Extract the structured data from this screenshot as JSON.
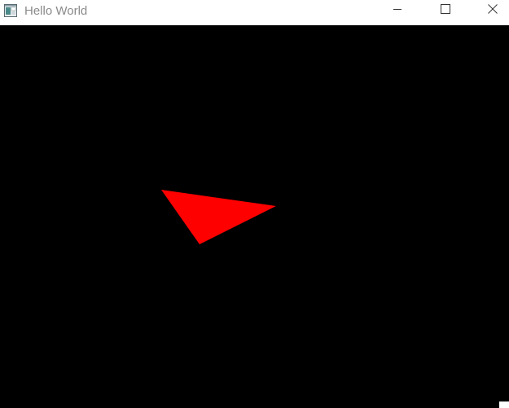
{
  "window": {
    "title": "Hello World"
  },
  "icons": {
    "app": "app-window-icon",
    "minimize": "minimize-icon",
    "maximize": "maximize-icon",
    "close": "close-icon"
  },
  "scene": {
    "background_color": "#000000",
    "shape": "triangle",
    "shape_color": "#ff0000"
  }
}
